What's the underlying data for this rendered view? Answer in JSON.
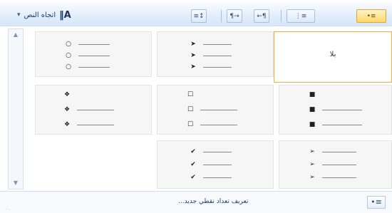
{
  "ribbon": {
    "text_direction_button": {
      "glyph": "‖A",
      "label": "اتجاه النص",
      "arrow": "▾"
    },
    "buttons": [
      {
        "icon": "line-spacing-icon",
        "glyph": "≡↕"
      },
      {
        "icon": "ltr-paragraph-icon",
        "glyph": "¶→"
      },
      {
        "icon": "rtl-paragraph-icon",
        "glyph": "←¶"
      },
      {
        "icon": "numbering-icon",
        "glyph": "⋮≡"
      },
      {
        "icon": "bullets-icon",
        "glyph": "•≡"
      }
    ]
  },
  "gallery": {
    "none_label": "بلا",
    "items": [
      {
        "name": "bullet-style-hollow-circle",
        "symbol": "○"
      },
      {
        "name": "bullet-style-arrowhead",
        "symbol": "➤"
      },
      {
        "name": "bullet-style-none",
        "symbol": ""
      },
      {
        "name": "bullet-style-four-diamond",
        "symbol": "❖"
      },
      {
        "name": "bullet-style-hollow-square",
        "symbol": "☐"
      },
      {
        "name": "bullet-style-filled-square",
        "symbol": "■"
      },
      {
        "name": "bullet-style-empty",
        "symbol": ""
      },
      {
        "name": "bullet-style-checkmark",
        "symbol": "✔"
      },
      {
        "name": "bullet-style-feather-arrow",
        "symbol": "➢"
      }
    ]
  },
  "footer": {
    "define_label": "تعريف تعداد نقطي جديد...",
    "icon": "define-bullet-icon"
  }
}
